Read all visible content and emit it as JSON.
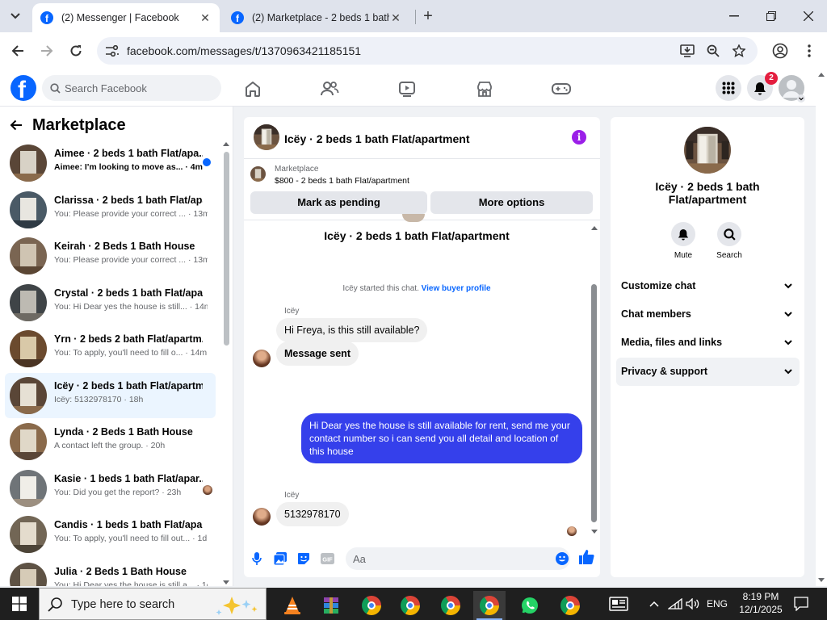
{
  "browser": {
    "tabs": [
      {
        "title": "(2) Messenger | Facebook",
        "active": true
      },
      {
        "title": "(2) Marketplace - 2 beds 1 bath",
        "active": false
      }
    ],
    "url": "facebook.com/messages/t/1370963421185151"
  },
  "fb": {
    "search_placeholder": "Search Facebook",
    "notification_count": "2"
  },
  "left": {
    "title": "Marketplace",
    "conversations": [
      {
        "name": "Aimee · 2 beds 1 bath Flat/apa...",
        "preview": "Aimee: I'm looking to move as... · 4m",
        "unread": true
      },
      {
        "name": "Clarissa · 2 beds 1 bath Flat/apa...",
        "preview": "You: Please provide your correct ... · 13m"
      },
      {
        "name": "Keirah · 2 Beds 1 Bath House",
        "preview": "You: Please provide your correct ... · 13m"
      },
      {
        "name": "Crystal · 2 beds 1 bath Flat/apar...",
        "preview": "You: Hi Dear yes the house is still... · 14m"
      },
      {
        "name": "Yrn · 2 beds 2 bath Flat/apartm...",
        "preview": "You: To apply, you'll need to fill o... · 14m"
      },
      {
        "name": "Icëy · 2 beds 1 bath Flat/apartm...",
        "preview": "Icëy: 5132978170 · 18h",
        "selected": true
      },
      {
        "name": "Lynda · 2 Beds 1 Bath House",
        "preview": "A contact left the group. · 20h"
      },
      {
        "name": "Kasie · 1 beds 1 bath Flat/apar...",
        "preview": "You: Did you get the report? · 23h"
      },
      {
        "name": "Candis · 1 beds 1 bath Flat/apart...",
        "preview": "You: To apply, you'll need to fill out... · 1d"
      },
      {
        "name": "Julia · 2 Beds 1 Bath House",
        "preview": "You: Hi Dear yes the house is still a... · 1d"
      }
    ]
  },
  "chat": {
    "title": "Icëy · 2 beds 1 bath Flat/apartment",
    "marketplace_label": "Marketplace",
    "listing": "$800 - 2 beds 1 bath Flat/apartment",
    "mark_pending": "Mark as pending",
    "more_options": "More options",
    "thread_title": "Icëy · 2 beds 1 bath Flat/apartment",
    "system_note": "Icëy started this chat.",
    "system_link": "View buyer profile",
    "sender_name": "Icëy",
    "messages": [
      {
        "from": "them",
        "text": "Hi Freya, is this still available?"
      },
      {
        "from": "them",
        "text": "Message sent"
      },
      {
        "from": "me",
        "text": "Hi Dear yes the house is still available for rent, send me your contact number so i can send you all detail and location of this house"
      },
      {
        "from": "them",
        "text": "5132978170"
      }
    ],
    "composer_placeholder": "Aa"
  },
  "right": {
    "name": "Icëy · 2 beds 1 bath Flat/apartment",
    "actions": [
      {
        "label": "Mute",
        "icon": "bell-icon"
      },
      {
        "label": "Search",
        "icon": "search-icon"
      }
    ],
    "sections": [
      "Customize chat",
      "Chat members",
      "Media, files and links",
      "Privacy & support"
    ]
  },
  "taskbar": {
    "search_placeholder": "Type here to search",
    "language": "ENG",
    "time": "8:19 PM",
    "date": "12/1/2025"
  },
  "colors": {
    "facebook_blue": "#0866ff",
    "outgoing_bubble": "#3540eb",
    "info_purple": "#9b1fe8",
    "notification_red": "#e41e3f"
  }
}
